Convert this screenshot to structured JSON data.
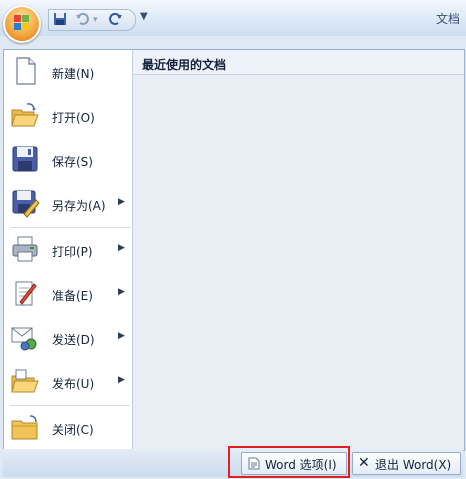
{
  "title_bar": {
    "document_title": "文档"
  },
  "qat": {
    "save_icon": "save-icon",
    "undo_icon": "undo-icon",
    "redo_icon": "redo-icon",
    "more": "▼"
  },
  "menu": {
    "items": [
      {
        "label": "新建(N)",
        "icon": "new-document-icon",
        "has_arrow": false
      },
      {
        "label": "打开(O)",
        "icon": "open-folder-icon",
        "has_arrow": false
      },
      {
        "label": "保存(S)",
        "icon": "floppy-disk-icon",
        "has_arrow": false
      },
      {
        "label": "另存为(A)",
        "icon": "save-as-icon",
        "has_arrow": true
      },
      {
        "label": "打印(P)",
        "icon": "printer-icon",
        "has_arrow": true
      },
      {
        "label": "准备(E)",
        "icon": "prepare-icon",
        "has_arrow": true
      },
      {
        "label": "发送(D)",
        "icon": "send-icon",
        "has_arrow": true
      },
      {
        "label": "发布(U)",
        "icon": "publish-icon",
        "has_arrow": true
      },
      {
        "label": "关闭(C)",
        "icon": "close-folder-icon",
        "has_arrow": false
      }
    ],
    "arrow_glyph": "▶",
    "recent_title": "最近使用的文档"
  },
  "bottom": {
    "options_label": "Word 选项(I)",
    "exit_label": "退出 Word(X)"
  },
  "colors": {
    "highlight": "#e0221f"
  }
}
